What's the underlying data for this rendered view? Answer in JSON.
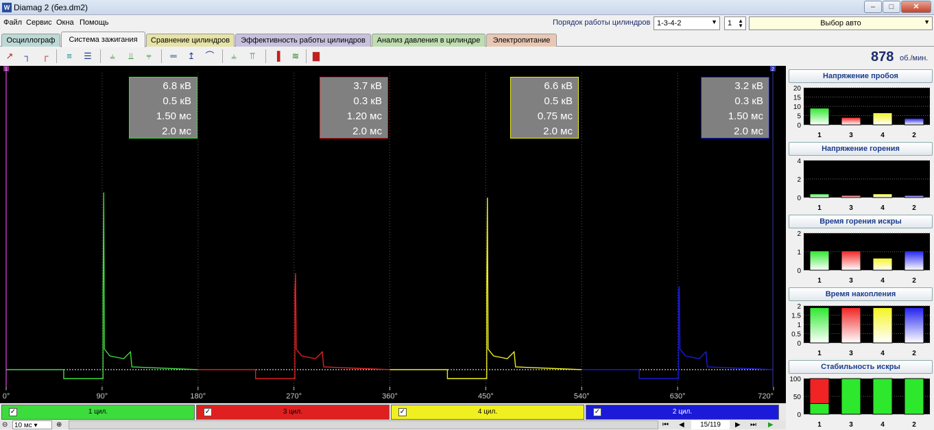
{
  "window": {
    "title": "Diamag 2 (без.dm2)",
    "icon": "app-icon"
  },
  "menu": [
    "Файл",
    "Сервис",
    "Окна",
    "Помощь"
  ],
  "order": {
    "label": "Порядок работы цилиндров",
    "value": "1-3-4-2",
    "cylinder": "1",
    "car_select": "Выбор авто"
  },
  "tabs": [
    {
      "label": "Осциллограф",
      "color": "#bcd9d6"
    },
    {
      "label": "Система зажигания",
      "color": "#f4f4f4",
      "active": true
    },
    {
      "label": "Сравнение цилиндров",
      "color": "#e7e3a6"
    },
    {
      "label": "Эффективность работы цилиндров",
      "color": "#c9c0dd"
    },
    {
      "label": "Анализ давления в цилиндре",
      "color": "#bfddb0"
    },
    {
      "label": "Электропитание",
      "color": "#e8c8b4"
    }
  ],
  "rpm": {
    "value": "878",
    "unit": "об./мин."
  },
  "scope": {
    "markers": [
      "1",
      "2"
    ],
    "x_ticks": [
      "0°",
      "90°",
      "180°",
      "270°",
      "360°",
      "450°",
      "540°",
      "630°",
      "720°"
    ],
    "cylinders": [
      {
        "name": "1 цил.",
        "color": "#3ddc3d",
        "values": [
          "6.8 кВ",
          "0.5 кВ",
          "1.50 мс",
          "2.0 мс"
        ]
      },
      {
        "name": "3 цил.",
        "color": "#e02020",
        "values": [
          "3.7 кВ",
          "0.3 кВ",
          "1.20 мс",
          "2.0 мс"
        ]
      },
      {
        "name": "4 цил.",
        "color": "#f0f020",
        "values": [
          "6.6 кВ",
          "0.5 кВ",
          "0.75 мс",
          "2.0 мс"
        ]
      },
      {
        "name": "2 цил.",
        "color": "#1a1ad8",
        "values": [
          "3.2 кВ",
          "0.3 кВ",
          "1.50 мс",
          "2.0 мс"
        ]
      }
    ]
  },
  "status": {
    "timebase": "10 мс",
    "frame": "15/119"
  },
  "panels": [
    {
      "title": "Напряжение пробоя",
      "yticks": [
        "20",
        "15",
        "10",
        "5",
        "0"
      ],
      "ymax": 20,
      "values": [
        9,
        4,
        6.5,
        3.5
      ]
    },
    {
      "title": "Напряжение горения",
      "yticks": [
        "4",
        "2",
        "0"
      ],
      "ymax": 5,
      "values": [
        0.5,
        0.3,
        0.5,
        0.3
      ]
    },
    {
      "title": "Время горения искры",
      "yticks": [
        "2",
        "1",
        "0"
      ],
      "ymax": 2.3,
      "values": [
        1.2,
        1.2,
        0.75,
        1.2
      ]
    },
    {
      "title": "Время накопления",
      "yticks": [
        "2",
        "1.5",
        "1",
        "0.5",
        "0"
      ],
      "ymax": 2.1,
      "values": [
        2.0,
        2.0,
        2.0,
        2.0
      ]
    },
    {
      "title": "Стабильность искры",
      "yticks": [
        "100",
        "50",
        "0"
      ],
      "ymax": 100,
      "values": [
        100,
        100,
        100,
        100
      ],
      "stable": [
        30,
        100,
        100,
        100
      ]
    }
  ],
  "bar_labels": [
    "1",
    "3",
    "4",
    "2"
  ],
  "bar_colors": [
    "#2ee82e",
    "#f02424",
    "#f4f422",
    "#2222ee"
  ]
}
